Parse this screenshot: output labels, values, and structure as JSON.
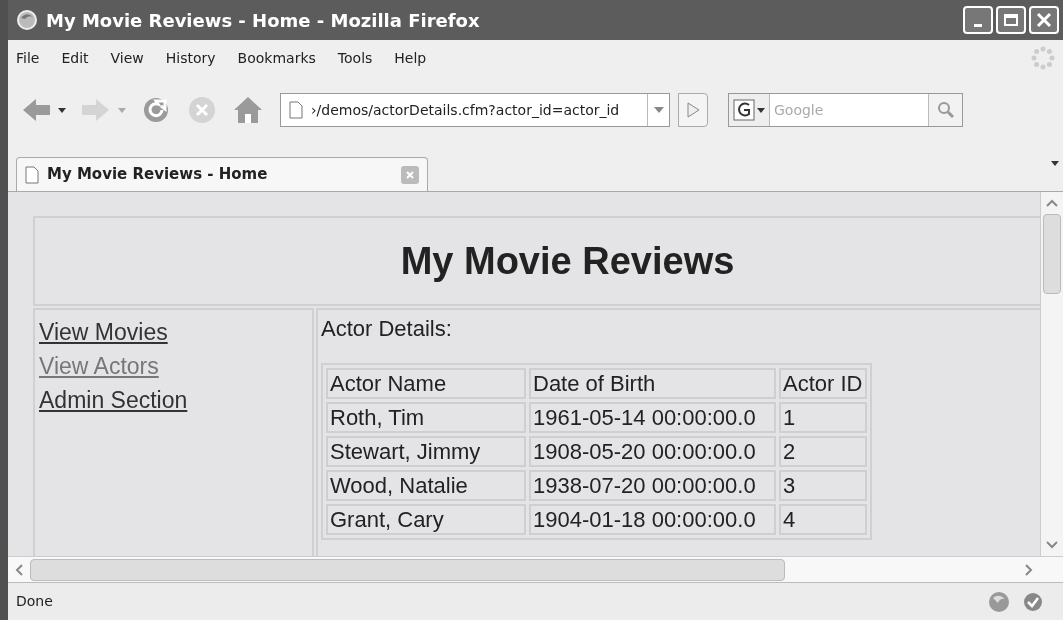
{
  "window": {
    "title": "My Movie Reviews - Home - Mozilla Firefox"
  },
  "menu": [
    {
      "label": "File"
    },
    {
      "label": "Edit"
    },
    {
      "label": "View"
    },
    {
      "label": "History"
    },
    {
      "label": "Bookmarks"
    },
    {
      "label": "Tools"
    },
    {
      "label": "Help"
    }
  ],
  "toolbar": [
    {
      "kind": "back",
      "disabled": false
    },
    {
      "kind": "forward",
      "disabled": true
    },
    {
      "kind": "reload",
      "disabled": false
    },
    {
      "kind": "stop",
      "disabled": true
    },
    {
      "kind": "home",
      "disabled": false
    }
  ],
  "address": {
    "value": "›/demos/actorDetails.cfm?actor_id=actor_id"
  },
  "search": {
    "placeholder": "Google"
  },
  "tabs": [
    {
      "label": "My Movie Reviews - Home",
      "selected": true
    }
  ],
  "page": {
    "heading": "My Movie Reviews",
    "nav_links": [
      {
        "label": "View Movies",
        "visited": false
      },
      {
        "label": "View Actors",
        "visited": true
      },
      {
        "label": "Admin Section",
        "visited": false
      }
    ],
    "section_title": "Actor Details:",
    "table": {
      "columns": [
        "Actor Name",
        "Date of Birth",
        "Actor ID"
      ],
      "rows": [
        [
          "Roth, Tim",
          "1961-05-14 00:00:00.0",
          "1"
        ],
        [
          "Stewart, Jimmy",
          "1908-05-20 00:00:00.0",
          "2"
        ],
        [
          "Wood, Natalie",
          "1938-07-20 00:00:00.0",
          "3"
        ],
        [
          "Grant, Cary",
          "1904-01-18 00:00:00.0",
          "4"
        ]
      ]
    }
  },
  "status_bar": {
    "text": "Done"
  }
}
